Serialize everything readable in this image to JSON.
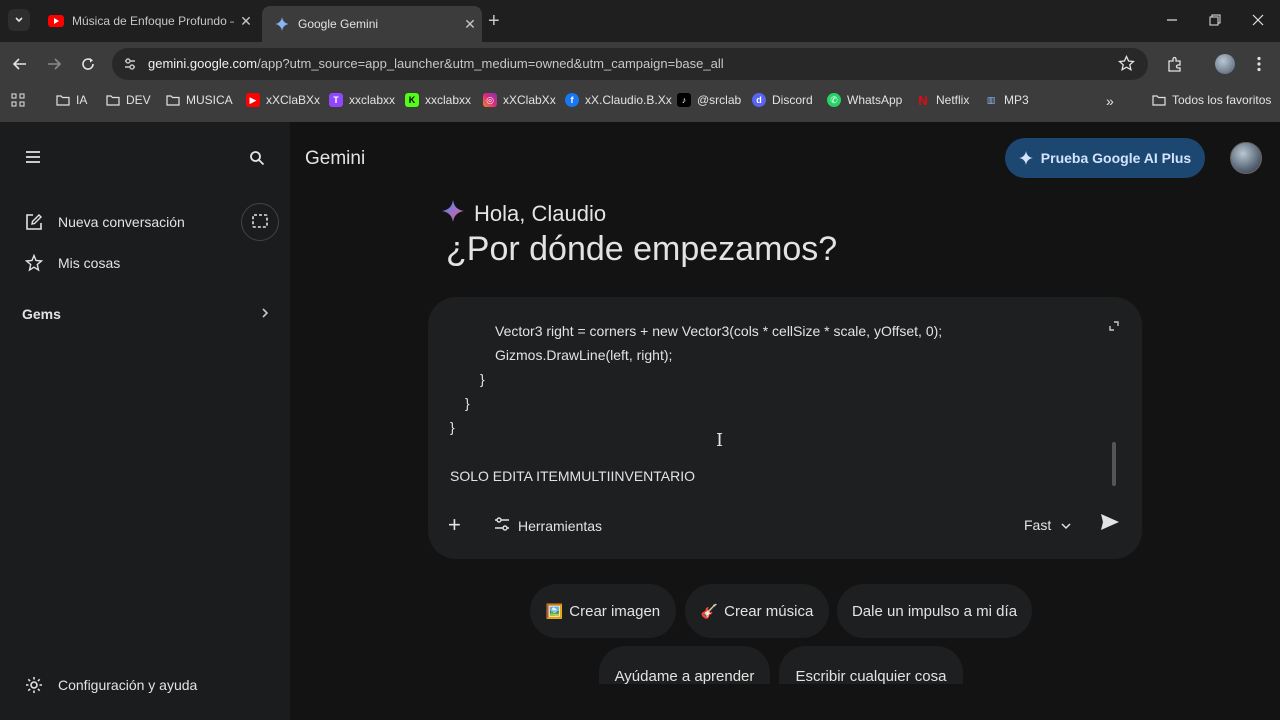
{
  "browser": {
    "tabs": [
      {
        "title": "Música de Enfoque Profundo –",
        "active": false,
        "favicon": "youtube-icon"
      },
      {
        "title": "Google Gemini",
        "active": true,
        "favicon": "gemini-icon"
      }
    ],
    "url": {
      "host": "gemini.google.com",
      "path": "/app?utm_source=app_launcher&utm_medium=owned&utm_campaign=base_all"
    },
    "bookmarks": [
      {
        "label": "IA",
        "icon": "folder-icon"
      },
      {
        "label": "DEV",
        "icon": "folder-icon"
      },
      {
        "label": "MUSICA",
        "icon": "folder-icon"
      },
      {
        "label": "xXClaBXx",
        "icon": "youtube-icon"
      },
      {
        "label": "xxclabxx",
        "icon": "twitch-icon"
      },
      {
        "label": "xxclabxx",
        "icon": "kick-icon"
      },
      {
        "label": "xXClabXx",
        "icon": "instagram-icon"
      },
      {
        "label": "xX.Claudio.B.Xx",
        "icon": "facebook-icon"
      },
      {
        "label": "@srclab",
        "icon": "tiktok-icon"
      },
      {
        "label": "Discord",
        "icon": "discord-icon"
      },
      {
        "label": "WhatsApp",
        "icon": "whatsapp-icon"
      },
      {
        "label": "Netflix",
        "icon": "netflix-icon"
      },
      {
        "label": "MP3",
        "icon": "mp3-icon"
      }
    ],
    "all_bookmarks_label": "Todos los favoritos",
    "colors": {
      "tabstrip": "#1f1f1f",
      "toolbar": "#3c3c3c"
    }
  },
  "sidebar": {
    "new_chat": "Nueva conversación",
    "my_stuff": "Mis cosas",
    "gems": "Gems",
    "settings": "Configuración y ayuda"
  },
  "main": {
    "brand": "Gemini",
    "upgrade_button": "Prueba Google AI Plus",
    "greeting": "Hola, Claudio",
    "question": "¿Por dónde empezamos?",
    "composer": {
      "code_lines": [
        "Vector3 right = corners + new Vector3(cols * cellSize * scale, yOffset, 0);",
        "Gizmos.DrawLine(left, right);",
        "}",
        "}",
        "}"
      ],
      "message": "SOLO EDITA ITEMMULTIINVENTARIO",
      "tools_label": "Herramientas",
      "mode_label": "Fast"
    },
    "suggestions": [
      {
        "label": "Crear imagen",
        "icon": "🖼️"
      },
      {
        "label": "Crear música",
        "icon": "🎸"
      },
      {
        "label": "Dale un impulso a mi día",
        "icon": ""
      },
      {
        "label": "Ayúdame a aprender",
        "icon": ""
      },
      {
        "label": "Escribir cualquier cosa",
        "icon": ""
      }
    ],
    "colors": {
      "upgrade_bg": "#1c4770",
      "upgrade_text": "#d3e3fd",
      "surface": "#1e1f20",
      "background": "#131314"
    }
  }
}
